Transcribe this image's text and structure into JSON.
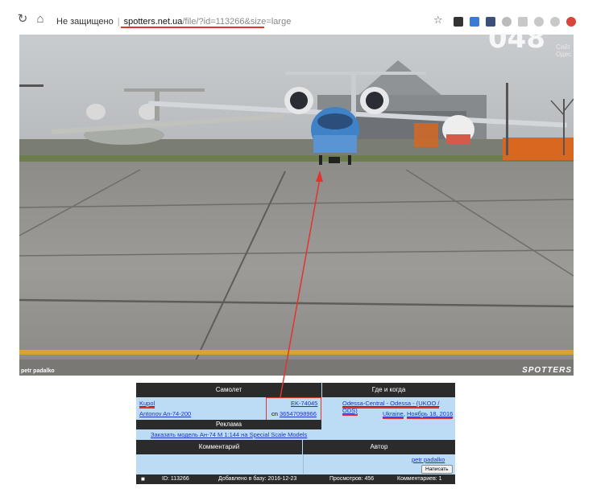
{
  "browser": {
    "security_label": "Не защищено",
    "url_host": "spotters.net.ua",
    "url_path": "/file/?id=113266&size=large"
  },
  "watermark": {
    "number": "048",
    "line1": "Сайт",
    "line2": "Одес"
  },
  "photo": {
    "credit": "petr padalko",
    "logo": "SPOTTERS"
  },
  "info": {
    "plane_header": "Самолет",
    "where_header": "Где и когда",
    "airline": "Kupol",
    "aircraft_type": "Antonov An-74-200",
    "registration": "EK-74045",
    "serial_prefix": "сn",
    "serial_number": "36547098966",
    "location": "Odessa-Central - Odessa - (UKOO / ODS)",
    "country": "Ukraine",
    "date": "Ноябрь 18, 2016",
    "ads_header": "Реклама",
    "ad_link": "Заказать модель Ан-74 М 1:144 на Special Scale Models",
    "comment_header": "Комментарий",
    "author_header": "Автор",
    "author_name": "petr padalko",
    "write_button": "Написать",
    "footer_id": "ID: 113266",
    "footer_added": "Добавлено в базу: 2016-12-23",
    "footer_views": "Просмотров: 456",
    "footer_comments": "Комментариев: 1"
  },
  "colors": {
    "accent_red": "#e0352c",
    "table_bg": "#bcdcf6",
    "header_bg": "#2b2b2b",
    "link": "#1a35c8"
  }
}
